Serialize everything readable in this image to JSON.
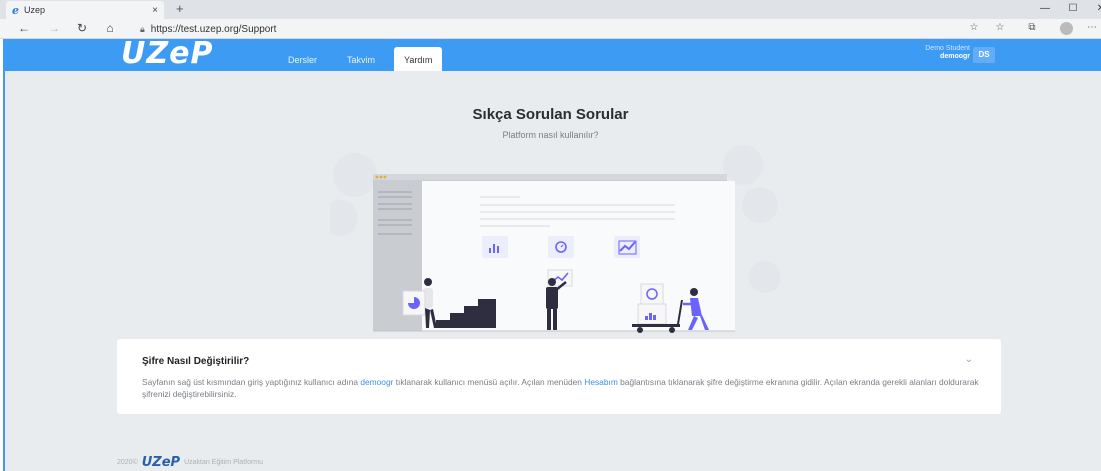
{
  "browser": {
    "tab_title": "Uzep",
    "tab_close": "×",
    "new_tab": "+",
    "url": "https://test.uzep.org/Support",
    "window_controls": {
      "minimize": "—",
      "maximize": "☐",
      "close": "✕"
    }
  },
  "header": {
    "logo": "UZeP",
    "nav": [
      {
        "label": "Dersler"
      },
      {
        "label": "Takvim"
      },
      {
        "label": "Yardım",
        "active": true
      }
    ],
    "user_role": "Demo Student",
    "user_name": "demoogr",
    "avatar_initials": "DS"
  },
  "main": {
    "title": "Sıkça Sorulan Sorular",
    "subtitle": "Platform nasıl kullanılır?"
  },
  "faq": {
    "question": "Şifre Nasıl Değiştirilir?",
    "chevron": "⌄",
    "answer_part1": "Sayfanın sağ üst kısmından giriş yaptığınız kullanıcı adına ",
    "answer_link1": "demoogr",
    "answer_part2": " tıklanarak kullanıcı menüsü açılır. Açılan menüden ",
    "answer_link2": "Hesabım",
    "answer_part3": " bağlantısına tıklanarak şifre değiştirme ekranına gidilir. Açılan ekranda gerekli alanları doldurarak şifrenizi değiştirebilirsiniz."
  },
  "footer": {
    "year": "2020©",
    "logo": "UZeP",
    "tagline": "Uzaktan Eğitim Platformu"
  },
  "colors": {
    "brand_blue": "#3d9bf4",
    "illus_purple": "#6c63ff",
    "background": "#e9ecef"
  }
}
